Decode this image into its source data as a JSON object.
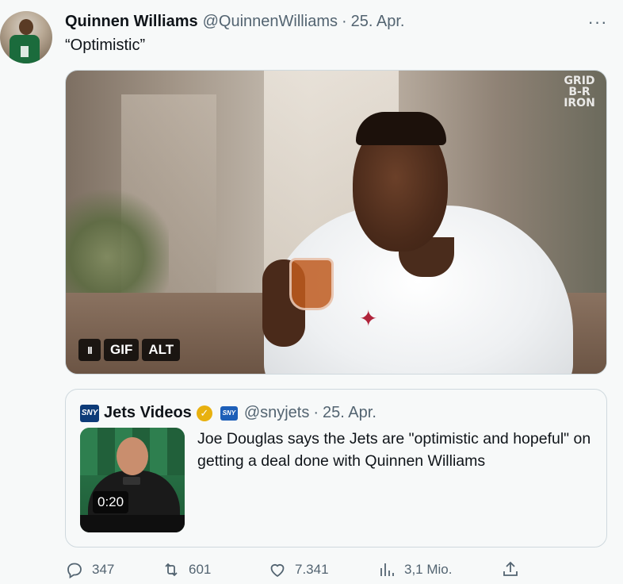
{
  "tweet": {
    "author_name": "Quinnen Williams",
    "author_handle": "@QuinnenWilliams",
    "separator": "·",
    "date": "25. Apr.",
    "more_label": "···",
    "text": "“Optimistic”",
    "media": {
      "watermark": "GRID\nB-R\nIRON",
      "pause_label": "II",
      "gif_label": "GIF",
      "alt_label": "ALT"
    }
  },
  "quote": {
    "logo_text": "SNY",
    "author_name": "Jets Videos",
    "verified_icon": "verified-gold-check",
    "affiliate_logo_text": "SNY",
    "author_handle": "@snyjets",
    "separator": "·",
    "date": "25. Apr.",
    "text": "Joe Douglas says the Jets are \"optimistic and hopeful\" on getting a deal done with Quinnen Williams",
    "video_duration": "0:20"
  },
  "actions": {
    "reply_count": "347",
    "retweet_count": "601",
    "like_count": "7.341",
    "views_count": "3,1 Mio.",
    "icons": [
      "reply-icon",
      "retweet-icon",
      "like-icon",
      "views-icon",
      "share-icon"
    ]
  },
  "colors": {
    "text_primary": "#0f1419",
    "text_secondary": "#536471",
    "border": "#cfd9de",
    "background": "#f7f9f9",
    "verified_gold": "#e8b10f",
    "sny_blue": "#0d3b78"
  }
}
